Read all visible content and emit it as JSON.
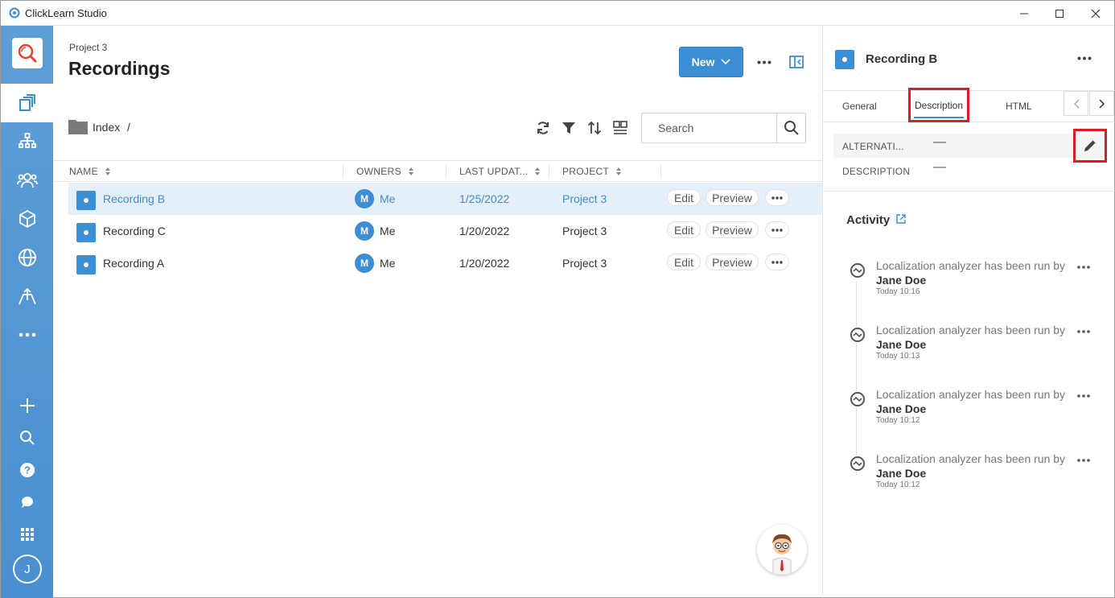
{
  "window": {
    "title": "ClickLearn Studio"
  },
  "sidebar": {
    "avatar_initial": "J",
    "icons": [
      "clicklearn-logo-icon",
      "recordings-icon",
      "hierarchy-icon",
      "users-icon",
      "package-icon",
      "globe-icon",
      "publish-icon",
      "more-icon",
      "add-icon",
      "search-icon",
      "help-icon",
      "chat-icon",
      "apps-grid-icon"
    ]
  },
  "header": {
    "project": "Project 3",
    "title": "Recordings",
    "new_label": "New"
  },
  "toolbar": {
    "folder_label": "Index",
    "separator": "/",
    "search_placeholder": "Search"
  },
  "table": {
    "columns": [
      "NAME",
      "OWNERS",
      "LAST UPDAT...",
      "PROJECT"
    ],
    "rows": [
      {
        "name": "Recording B",
        "owner_initial": "M",
        "owner": "Me",
        "updated": "1/25/2022",
        "project": "Project 3",
        "edit": "Edit",
        "preview": "Preview",
        "selected": true
      },
      {
        "name": "Recording C",
        "owner_initial": "M",
        "owner": "Me",
        "updated": "1/20/2022",
        "project": "Project 3",
        "edit": "Edit",
        "preview": "Preview",
        "selected": false
      },
      {
        "name": "Recording A",
        "owner_initial": "M",
        "owner": "Me",
        "updated": "1/20/2022",
        "project": "Project 3",
        "edit": "Edit",
        "preview": "Preview",
        "selected": false
      }
    ]
  },
  "details": {
    "title": "Recording B",
    "tabs": [
      "General",
      "Description",
      "HTML"
    ],
    "active_tab": "Description",
    "properties": [
      {
        "key": "ALTERNATI...",
        "value": "—"
      },
      {
        "key": "DESCRIPTION",
        "value": "—"
      }
    ],
    "activity_title": "Activity",
    "activity": [
      {
        "text": "Localization analyzer has been run by",
        "user": "Jane Doe",
        "time": "Today 10:16"
      },
      {
        "text": "Localization analyzer has been run by",
        "user": "Jane Doe",
        "time": "Today 10:13"
      },
      {
        "text": "Localization analyzer has been run by",
        "user": "Jane Doe",
        "time": "Today 10:12"
      },
      {
        "text": "Localization analyzer has been run by",
        "user": "Jane Doe",
        "time": "Today 10:12"
      }
    ]
  },
  "colors": {
    "accent": "#3c8fd4",
    "sidebar": "#4a90d0",
    "highlight": "#e11b22",
    "selected_row": "#e4eff9"
  }
}
